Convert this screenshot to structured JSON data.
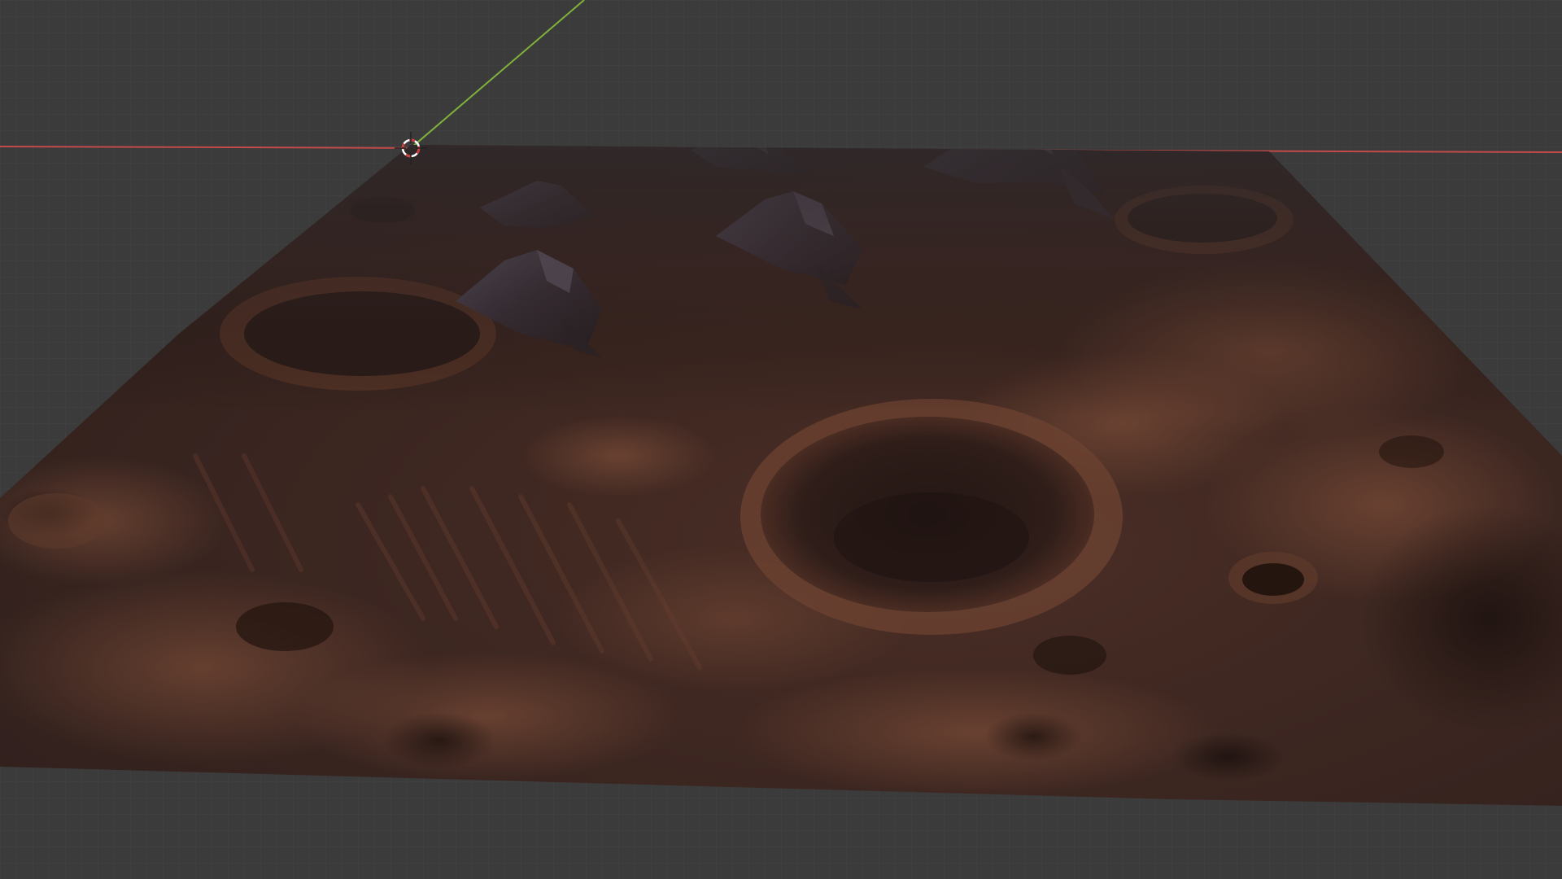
{
  "app": {
    "name": "",
    "editor": "3D Viewport"
  },
  "viewport": {
    "background_color": "#3b3b3b",
    "grid_color": "#4a4a4a",
    "grid_subcolor": "#434343",
    "x_axis_color": "#c44a4a",
    "y_axis_color": "#7fb23a"
  },
  "scene": {
    "object": {
      "type": "terrain-plane",
      "material": "martian-regolith",
      "base_color": "#3a2621",
      "highlight_color": "#7a4a36",
      "peak_color": "#4a4250"
    },
    "features": {
      "mountain_peaks": 5,
      "large_craters": 3,
      "small_craters": 6
    },
    "cursor": {
      "name": "3d-cursor"
    }
  }
}
